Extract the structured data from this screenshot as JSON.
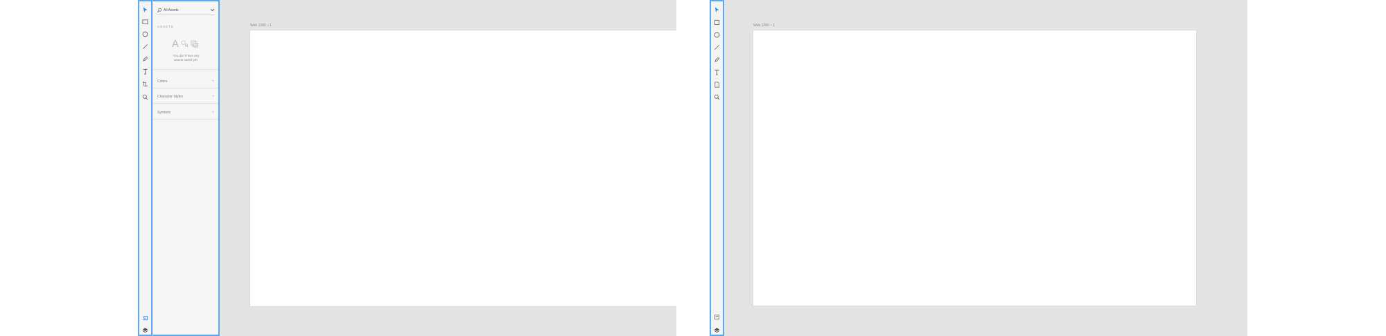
{
  "colors": {
    "selection_border": "#59a8f0",
    "canvas": "#e4e4e4",
    "toolbar": "#f4f4f4",
    "assets_panel": "#f6f6f6",
    "artboard": "#ffffff",
    "icon": "#5a5a5a",
    "accent_icon": "#2d8ceb"
  },
  "left_window": {
    "toolbar": {
      "tools": [
        "select-tool",
        "rectangle-tool",
        "ellipse-tool",
        "line-tool",
        "pen-tool",
        "text-tool",
        "artboard-tool",
        "zoom-tool"
      ],
      "bottom": [
        "assets-icon",
        "layers-icon"
      ]
    },
    "assets_panel": {
      "search_value": "All Assets",
      "title": "ASSETS",
      "empty_message_line1": "You don't have any",
      "empty_message_line2": "assets saved yet.",
      "sections": [
        {
          "label": "Colors"
        },
        {
          "label": "Character Styles"
        },
        {
          "label": "Symbols"
        }
      ],
      "add_glyph": "+"
    },
    "artboard_label": "Web 1280 – 1"
  },
  "right_window": {
    "toolbar": {
      "tools": [
        "select-tool",
        "rectangle-tool",
        "ellipse-tool",
        "line-tool",
        "pen-tool",
        "text-tool",
        "artboard-tool",
        "zoom-tool"
      ],
      "bottom": [
        "assets-icon",
        "layers-icon"
      ]
    },
    "artboard_label": "Web 1280 – 1"
  }
}
